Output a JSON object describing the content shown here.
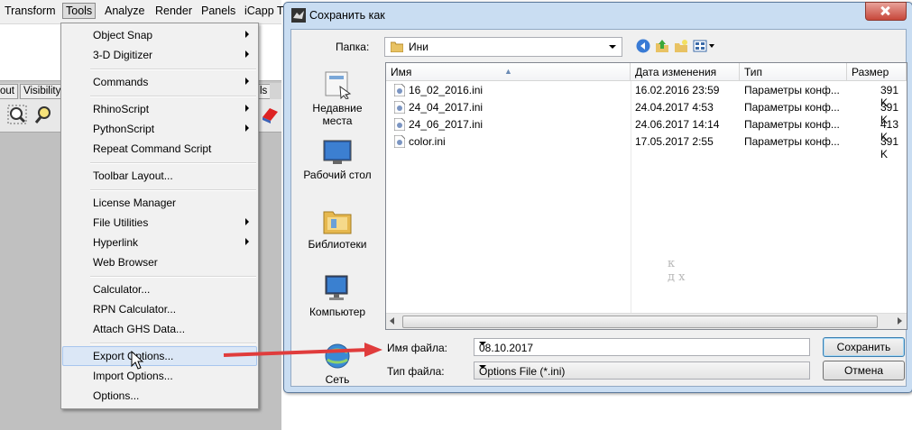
{
  "app": {
    "menubar": [
      "Transform",
      "Tools",
      "Analyze",
      "Render",
      "Panels",
      "iCapp T"
    ],
    "tabs": [
      "out",
      "Visibility",
      "ls"
    ]
  },
  "tools_menu": {
    "items": [
      {
        "label": "Object Snap",
        "submenu": true
      },
      {
        "label": "3-D Digitizer",
        "submenu": true
      },
      {
        "label": "Commands",
        "submenu": true
      },
      {
        "label": "RhinoScript",
        "submenu": true
      },
      {
        "label": "PythonScript",
        "submenu": true
      },
      {
        "label": "Repeat Command Script",
        "submenu": false
      },
      {
        "label": "Toolbar Layout...",
        "submenu": false
      },
      {
        "label": "License Manager",
        "submenu": false
      },
      {
        "label": "File Utilities",
        "submenu": true
      },
      {
        "label": "Hyperlink",
        "submenu": true
      },
      {
        "label": "Web Browser",
        "submenu": false
      },
      {
        "label": "Calculator...",
        "submenu": false
      },
      {
        "label": "RPN Calculator...",
        "submenu": false
      },
      {
        "label": "Attach GHS Data...",
        "submenu": false
      },
      {
        "label": "Export Options...",
        "submenu": false,
        "highlighted": true
      },
      {
        "label": "Import Options...",
        "submenu": false
      },
      {
        "label": "Options...",
        "submenu": false
      }
    ]
  },
  "dialog": {
    "title": "Сохранить как",
    "folder_label": "Папка:",
    "folder_value": "Ини",
    "places": [
      "Недавние места",
      "Рабочий стол",
      "Библиотеки",
      "Компьютер",
      "Сеть"
    ],
    "columns": [
      "Имя",
      "Дата изменения",
      "Тип",
      "Размер"
    ],
    "files": [
      {
        "name": "16_02_2016.ini",
        "date": "16.02.2016 23:59",
        "type": "Параметры конф...",
        "size": "391 K"
      },
      {
        "name": "24_04_2017.ini",
        "date": "24.04.2017 4:53",
        "type": "Параметры конф...",
        "size": "391 K"
      },
      {
        "name": "24_06_2017.ini",
        "date": "24.06.2017 14:14",
        "type": "Параметры конф...",
        "size": "413 K"
      },
      {
        "name": "color.ini",
        "date": "17.05.2017 2:55",
        "type": "Параметры конф...",
        "size": "391 K"
      }
    ],
    "filename_label": "Имя файла:",
    "filename_value": "08.10.2017",
    "filetype_label": "Тип файла:",
    "filetype_value": "Options File (*.ini)",
    "save_label": "Сохранить",
    "cancel_label": "Отмена"
  },
  "watermark": "к д х",
  "colors": {
    "arrow": "#e03c3c",
    "menu_highlight": "#dbe7f6",
    "dialog_frame": "#c9ddf2"
  }
}
